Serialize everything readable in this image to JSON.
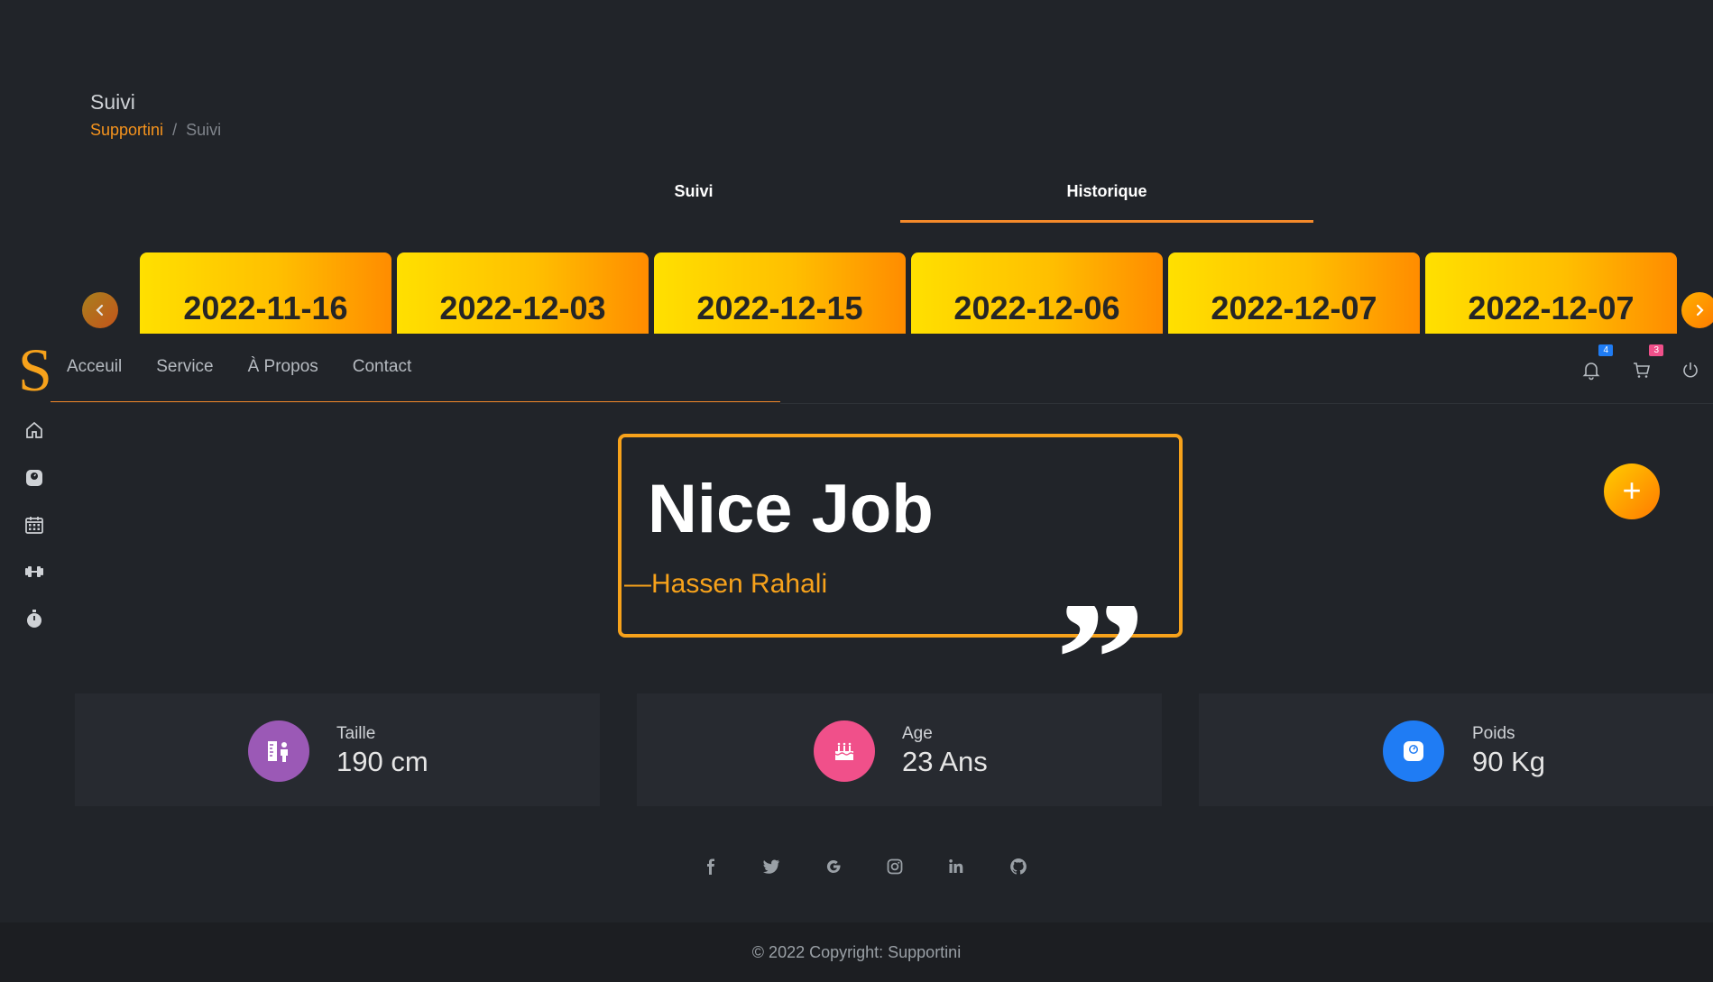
{
  "header": {
    "title": "Suivi",
    "breadcrumb": {
      "root": "Supportini",
      "separator": "/",
      "current": "Suivi"
    }
  },
  "tabs": [
    {
      "label": "Suivi",
      "active": false
    },
    {
      "label": "Historique",
      "active": true
    }
  ],
  "carousel": {
    "dates": [
      "2022-11-16",
      "2022-12-03",
      "2022-12-15",
      "2022-12-06",
      "2022-12-07",
      "2022-12-07"
    ],
    "prev_icon": "chevron-left-icon",
    "next_icon": "chevron-right-icon"
  },
  "navbar": {
    "logo": "S",
    "links": [
      "Acceuil",
      "Service",
      "À Propos",
      "Contact"
    ],
    "notifications_count": "4",
    "cart_count": "3",
    "icons": [
      "bell-icon",
      "cart-icon",
      "power-icon"
    ]
  },
  "sidebar": {
    "icons": [
      "home-icon",
      "weight-scale-icon",
      "calendar-icon",
      "dumbbell-icon",
      "stopwatch-icon"
    ]
  },
  "quote": {
    "text": "Nice Job",
    "author": "—Hassen Rahali",
    "mark": "”"
  },
  "fab": {
    "label": "+"
  },
  "stats": [
    {
      "label": "Taille",
      "value": "190 cm",
      "icon": "height-measure-icon",
      "color": "#9b59b6"
    },
    {
      "label": "Age",
      "value": "23 Ans",
      "icon": "birthday-cake-icon",
      "color": "#f0508a"
    },
    {
      "label": "Poids",
      "value": "90 Kg",
      "icon": "weight-scale-icon",
      "color": "#1f7cf4"
    }
  ],
  "social": [
    "facebook-icon",
    "twitter-icon",
    "google-icon",
    "instagram-icon",
    "linkedin-icon",
    "github-icon"
  ],
  "colors": {
    "accent": "#f7a21b",
    "background": "#212429",
    "badge_blue": "#1f7cf4",
    "badge_pink": "#f0508a"
  },
  "footer": {
    "text": "© 2022 Copyright: Supportini"
  }
}
